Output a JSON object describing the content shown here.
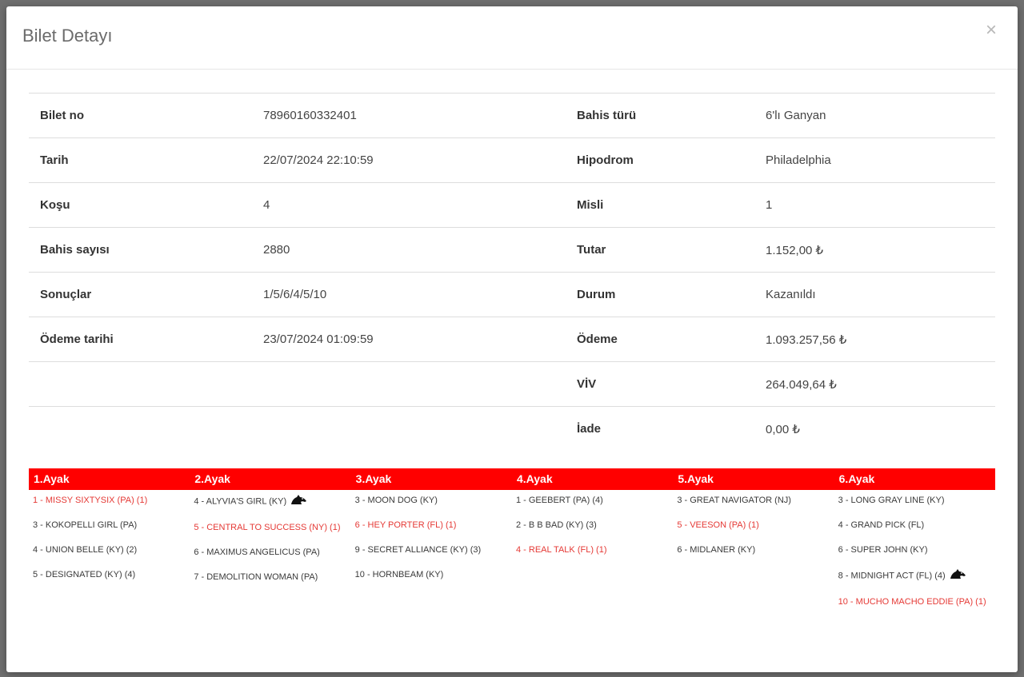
{
  "modal": {
    "title": "Bilet Detayı",
    "close_label": "×"
  },
  "details": [
    {
      "left_label": "Bilet no",
      "left_value": "78960160332401",
      "right_label": "Bahis türü",
      "right_value": "6'lı Ganyan"
    },
    {
      "left_label": "Tarih",
      "left_value": "22/07/2024 22:10:59",
      "right_label": "Hipodrom",
      "right_value": "Philadelphia"
    },
    {
      "left_label": "Koşu",
      "left_value": "4",
      "right_label": "Misli",
      "right_value": "1"
    },
    {
      "left_label": "Bahis sayısı",
      "left_value": "2880",
      "right_label": "Tutar",
      "right_value": "1.152,00 ₺"
    },
    {
      "left_label": "Sonuçlar",
      "left_value": "1/5/6/4/5/10",
      "right_label": "Durum",
      "right_value": "Kazanıldı"
    },
    {
      "left_label": "Ödeme tarihi",
      "left_value": "23/07/2024 01:09:59",
      "right_label": "Ödeme",
      "right_value": "1.093.257,56 ₺"
    },
    {
      "left_label": "",
      "left_value": "",
      "right_label": "VİV",
      "right_value": "264.049,64 ₺"
    },
    {
      "left_label": "",
      "left_value": "",
      "right_label": "İade",
      "right_value": "0,00 ₺"
    }
  ],
  "colors": {
    "leg_header_bg": "#ff0000",
    "winner_text": "#e53935"
  },
  "legs": [
    {
      "title": "1.Ayak",
      "horses": [
        {
          "text": "1 - MISSY SIXTYSIX (PA) (1)",
          "winner": true
        },
        {
          "text": "3 - KOKOPELLI GIRL (PA)",
          "winner": false
        },
        {
          "text": "4 - UNION BELLE (KY) (2)",
          "winner": false
        },
        {
          "text": "5 - DESIGNATED (KY) (4)",
          "winner": false
        }
      ]
    },
    {
      "title": "2.Ayak",
      "horses": [
        {
          "text": "4 - ALYVIA'S GIRL (KY)",
          "winner": false,
          "icon": "horse-head-icon"
        },
        {
          "text": "5 - CENTRAL TO SUCCESS (NY) (1)",
          "winner": true
        },
        {
          "text": "6 - MAXIMUS ANGELICUS (PA)",
          "winner": false
        },
        {
          "text": "7 - DEMOLITION WOMAN (PA)",
          "winner": false
        }
      ]
    },
    {
      "title": "3.Ayak",
      "horses": [
        {
          "text": "3 - MOON DOG (KY)",
          "winner": false
        },
        {
          "text": "6 - HEY PORTER (FL) (1)",
          "winner": true
        },
        {
          "text": "9 - SECRET ALLIANCE (KY) (3)",
          "winner": false
        },
        {
          "text": "10 - HORNBEAM (KY)",
          "winner": false
        }
      ]
    },
    {
      "title": "4.Ayak",
      "horses": [
        {
          "text": "1 - GEEBERT (PA) (4)",
          "winner": false
        },
        {
          "text": "2 - B B BAD (KY) (3)",
          "winner": false
        },
        {
          "text": "4 - REAL TALK (FL) (1)",
          "winner": true
        }
      ]
    },
    {
      "title": "5.Ayak",
      "horses": [
        {
          "text": "3 - GREAT NAVIGATOR (NJ)",
          "winner": false
        },
        {
          "text": "5 - VEESON (PA) (1)",
          "winner": true
        },
        {
          "text": "6 - MIDLANER (KY)",
          "winner": false
        }
      ]
    },
    {
      "title": "6.Ayak",
      "horses": [
        {
          "text": "3 - LONG GRAY LINE (KY)",
          "winner": false
        },
        {
          "text": "4 - GRAND PICK (FL)",
          "winner": false
        },
        {
          "text": "6 - SUPER JOHN (KY)",
          "winner": false
        },
        {
          "text": "8 - MIDNIGHT ACT (FL) (4)",
          "winner": false,
          "icon": "horse-head-icon"
        },
        {
          "text": "10 - MUCHO MACHO EDDIE (PA) (1)",
          "winner": true
        }
      ]
    }
  ]
}
